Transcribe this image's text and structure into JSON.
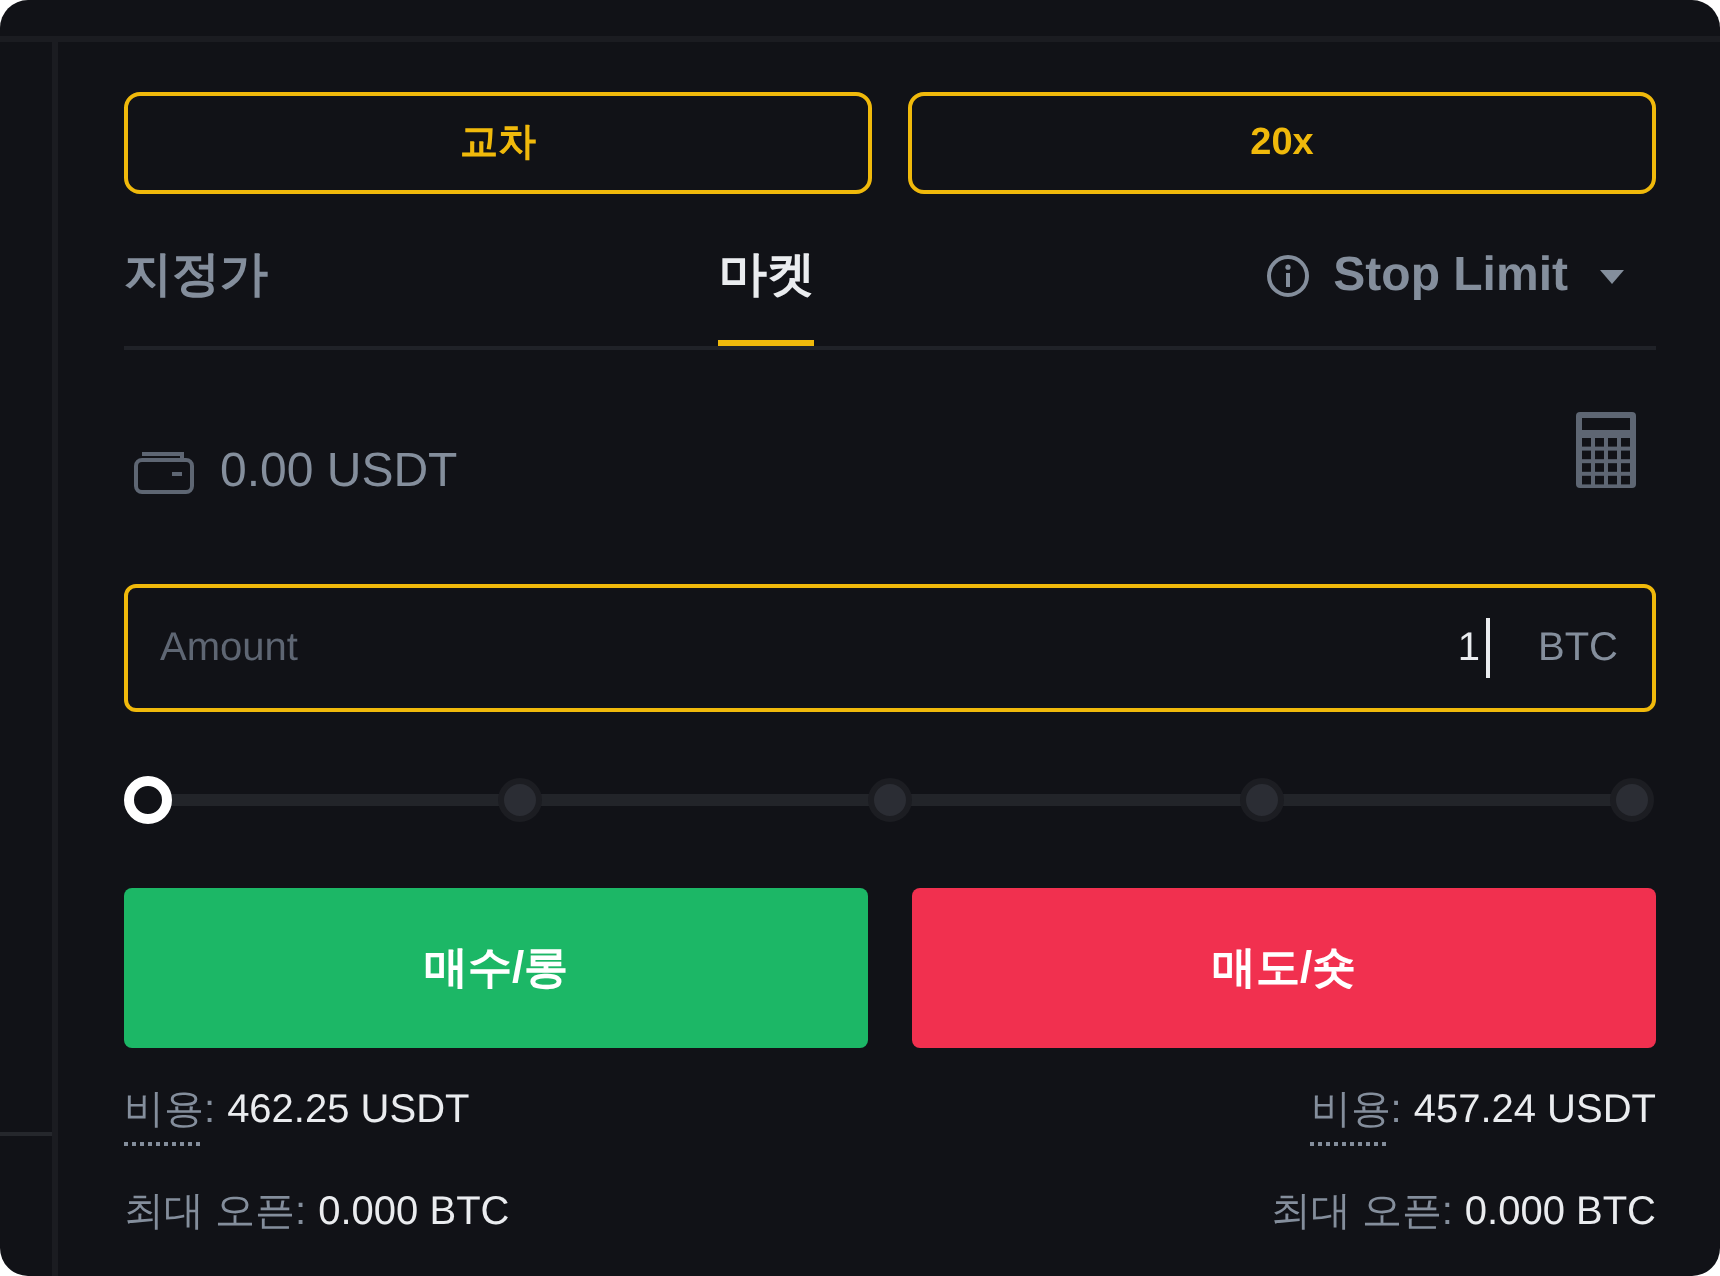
{
  "margin_mode": {
    "label": "교차"
  },
  "leverage": {
    "label": "20x"
  },
  "order_types": [
    {
      "label": "지정가",
      "kind": "tab",
      "selected": false
    },
    {
      "label": "마켓",
      "kind": "tab",
      "selected": true
    },
    {
      "label": "Stop Limit",
      "kind": "dropdown",
      "selected": false
    }
  ],
  "balance": {
    "value": "0.00 USDT"
  },
  "amount_field": {
    "label": "Amount",
    "value": "1",
    "unit": "BTC",
    "focused": true
  },
  "slider": {
    "level": 0
  },
  "actions": [
    {
      "label": "매수/롱",
      "kind": "buy"
    },
    {
      "label": "매도/숏",
      "kind": "sell"
    }
  ],
  "summary": {
    "buy": [
      {
        "label": "비용:",
        "value": "462.25 USDT",
        "tooltip": true
      },
      {
        "label": "최대 오픈:",
        "value": "0.000 BTC",
        "tooltip": false
      }
    ],
    "sell": [
      {
        "label": "비용:",
        "value": "457.24 USDT",
        "tooltip": true
      },
      {
        "label": "최대 오픈:",
        "value": "0.000 BTC",
        "tooltip": false
      }
    ]
  }
}
